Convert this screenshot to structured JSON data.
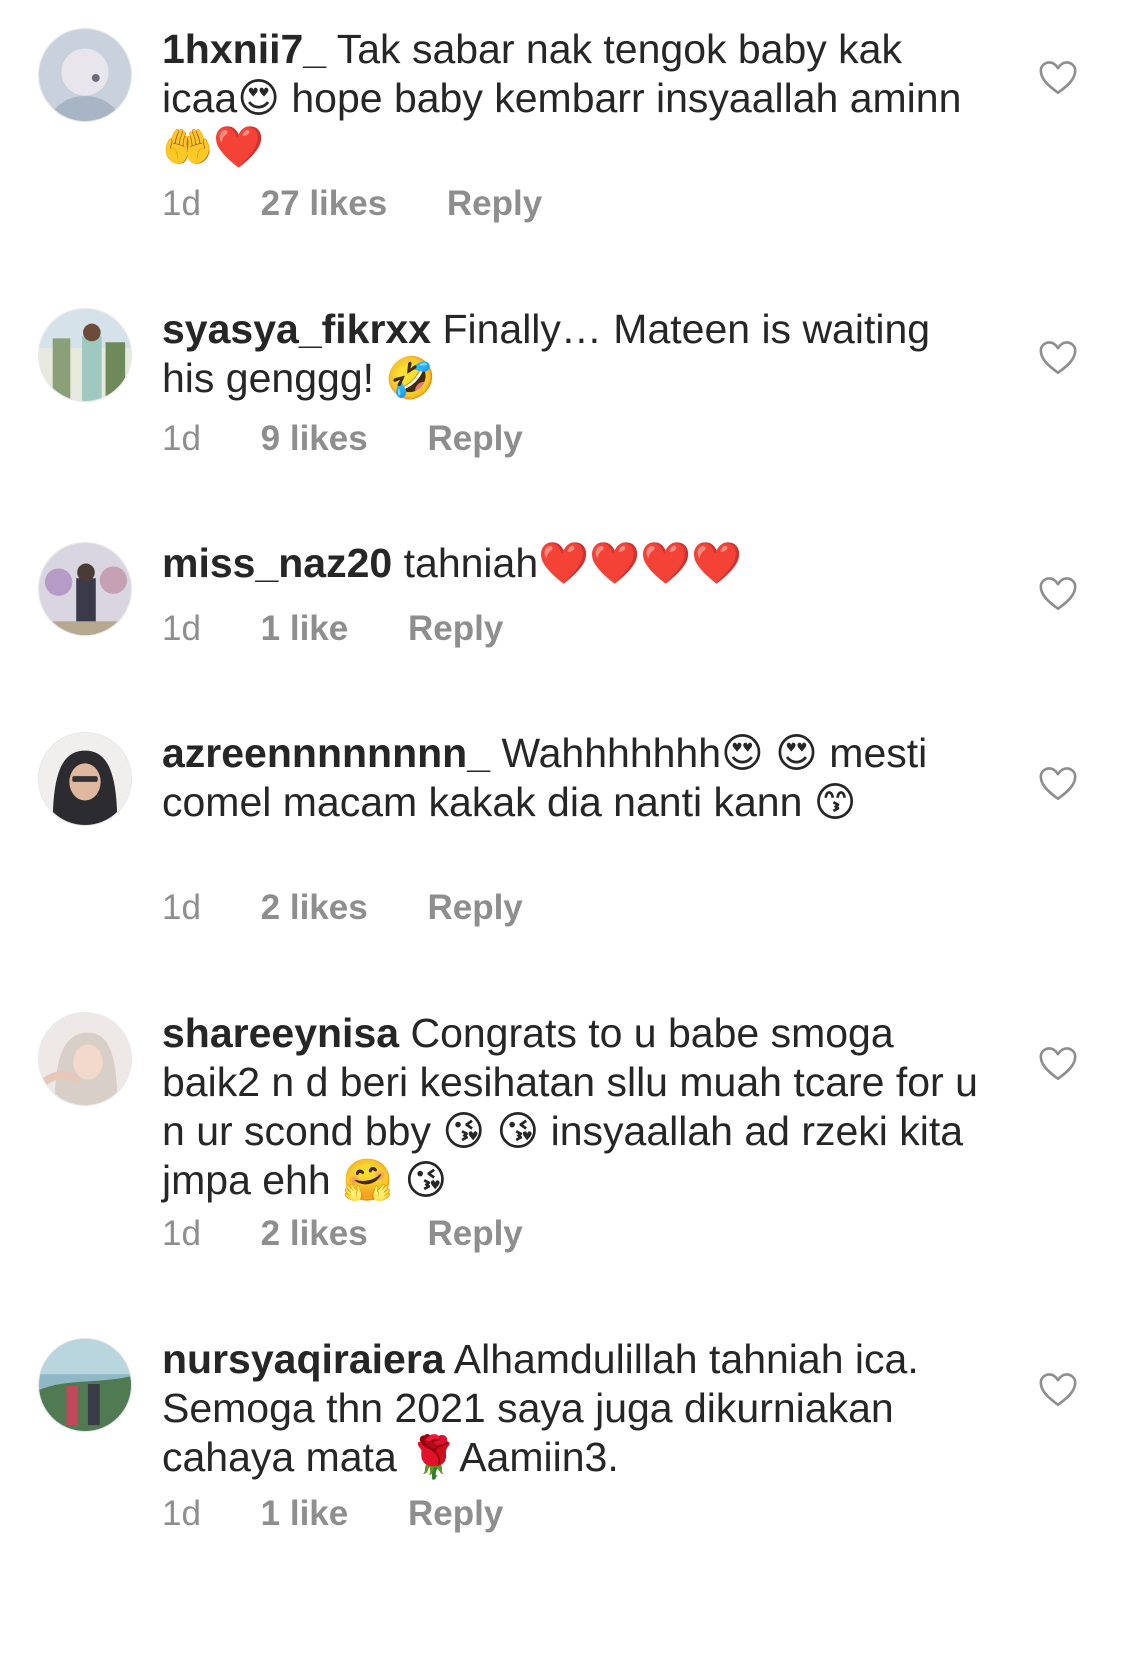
{
  "comments": [
    {
      "username": "1hxnii7_",
      "text": "Tak sabar nak tengok baby kak icaa😍 hope baby kembarr insyaallah aminn🤲❤️",
      "time": "1d",
      "likes": "27 likes",
      "reply": "Reply"
    },
    {
      "username": "syasya_fikrxx",
      "text": "Finally… Mateen is waiting his genggg! 🤣",
      "time": "1d",
      "likes": "9 likes",
      "reply": "Reply"
    },
    {
      "username": "miss_naz20",
      "text": "tahniah❤️❤️❤️❤️",
      "time": "1d",
      "likes": "1 like",
      "reply": "Reply"
    },
    {
      "username": "azreennnnnnnn_",
      "text": "Wahhhhhhh😍 😍 mesti comel macam kakak dia nanti kann 😙",
      "time": "1d",
      "likes": "2 likes",
      "reply": "Reply"
    },
    {
      "username": "shareeynisa",
      "text": "Congrats to u babe smoga baik2  n d beri kesihatan sllu muah tcare for u n ur scond bby 😘 😘 insyaallah ad rzeki kita jmpa ehh 🤗 😘",
      "time": "1d",
      "likes": "2 likes",
      "reply": "Reply"
    },
    {
      "username": "nursyaqiraiera",
      "text": "Alhamdulillah tahniah ica. Semoga thn 2021 saya juga dikurniakan cahaya mata 🌹Aamiin3.",
      "time": "1d",
      "likes": "1 like",
      "reply": "Reply"
    }
  ],
  "icons": {
    "like": "heart-outline-icon",
    "avatar": "user-avatar"
  }
}
